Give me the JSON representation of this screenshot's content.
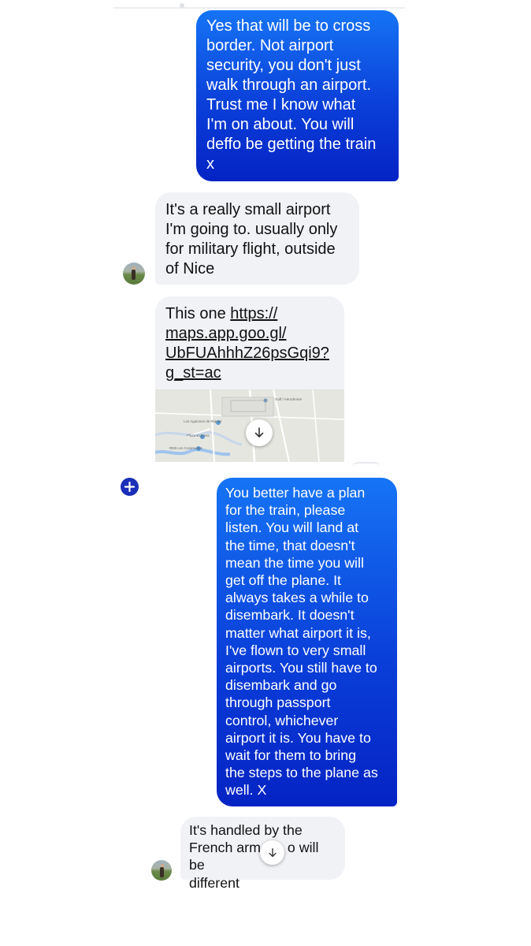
{
  "messages": [
    {
      "direction": "outgoing",
      "text": [
        "Yes that will be to cross",
        "border. Not airport",
        "security, you don't just",
        "walk through an airport.",
        "Trust me I know what",
        "I'm on about. You will",
        "deffo be getting the train",
        "x"
      ]
    },
    {
      "direction": "incoming",
      "text": [
        "It's a really small airport",
        "I'm going to. usually only",
        "for military flight, outside",
        "of Nice"
      ]
    },
    {
      "direction": "incoming",
      "prefix": "This one ",
      "link": [
        "https://",
        "maps.app.goo.gl/",
        "UbFUAhhhZ26psGqi9?",
        "g_st=ac"
      ],
      "map_labels": [
        "Los Aguiones de Riquier",
        "Plaza Express",
        "Golf / Aérodrome",
        "RD6 Les Communes"
      ]
    },
    {
      "direction": "outgoing",
      "text": [
        "You better have a plan",
        "for the train, please",
        "listen. You will land at",
        "the time, that doesn't",
        "mean the time you will",
        "get off the plane. It",
        "always takes a while to",
        "disembark. It doesn't",
        "matter what airport it is,",
        "I've flown to very small",
        "airports. You still have to",
        "disembark and go",
        "through passport",
        "control, whichever",
        "airport it is. You have to",
        "wait for them to bring",
        "the steps to the plane as",
        "well. X"
      ]
    },
    {
      "direction": "incoming",
      "text": [
        "It's handled by the",
        "French arm",
        "o will be",
        "different"
      ]
    }
  ],
  "icons": {
    "scroll_down": "arrow-down-icon",
    "add": "plus-icon",
    "avatar": "contact-avatar"
  },
  "colors": {
    "outgoing_top": "#1674f5",
    "outgoing_bottom": "#0523c4",
    "incoming_bg": "#f1f2f6",
    "plus_button": "#1a2fb8"
  }
}
